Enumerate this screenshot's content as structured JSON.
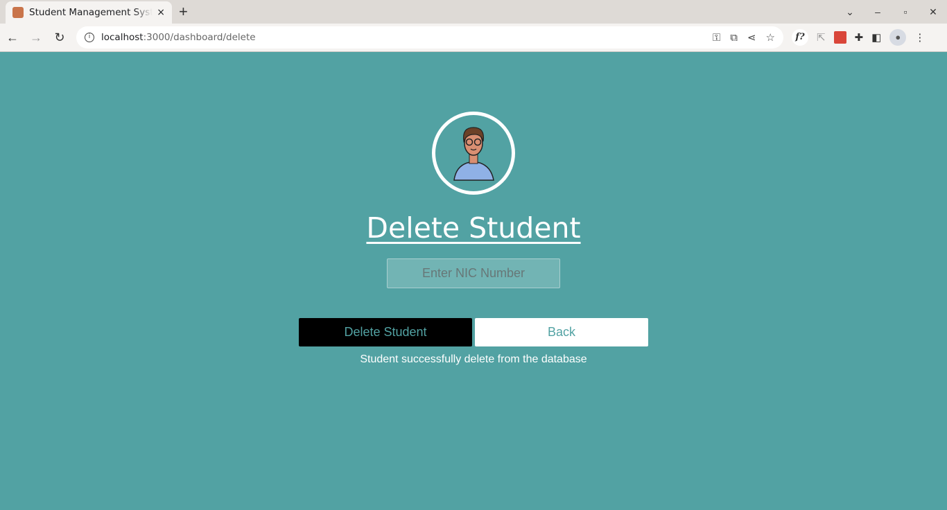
{
  "browser": {
    "tab_title": "Student Management System",
    "close_tab": "×",
    "new_tab": "+",
    "url_host": "localhost",
    "url_path": ":3000/dashboard/delete",
    "window_controls": [
      "⌄",
      "–",
      "▫",
      "✕"
    ]
  },
  "page": {
    "title": "Delete Student",
    "nic_placeholder": "Enter NIC Number",
    "nic_value": "",
    "delete_label": "Delete Student",
    "back_label": "Back",
    "status_message": "Student successfully delete from the database"
  },
  "colors": {
    "background": "#52a2a3",
    "button_text": "#52a2a3"
  }
}
